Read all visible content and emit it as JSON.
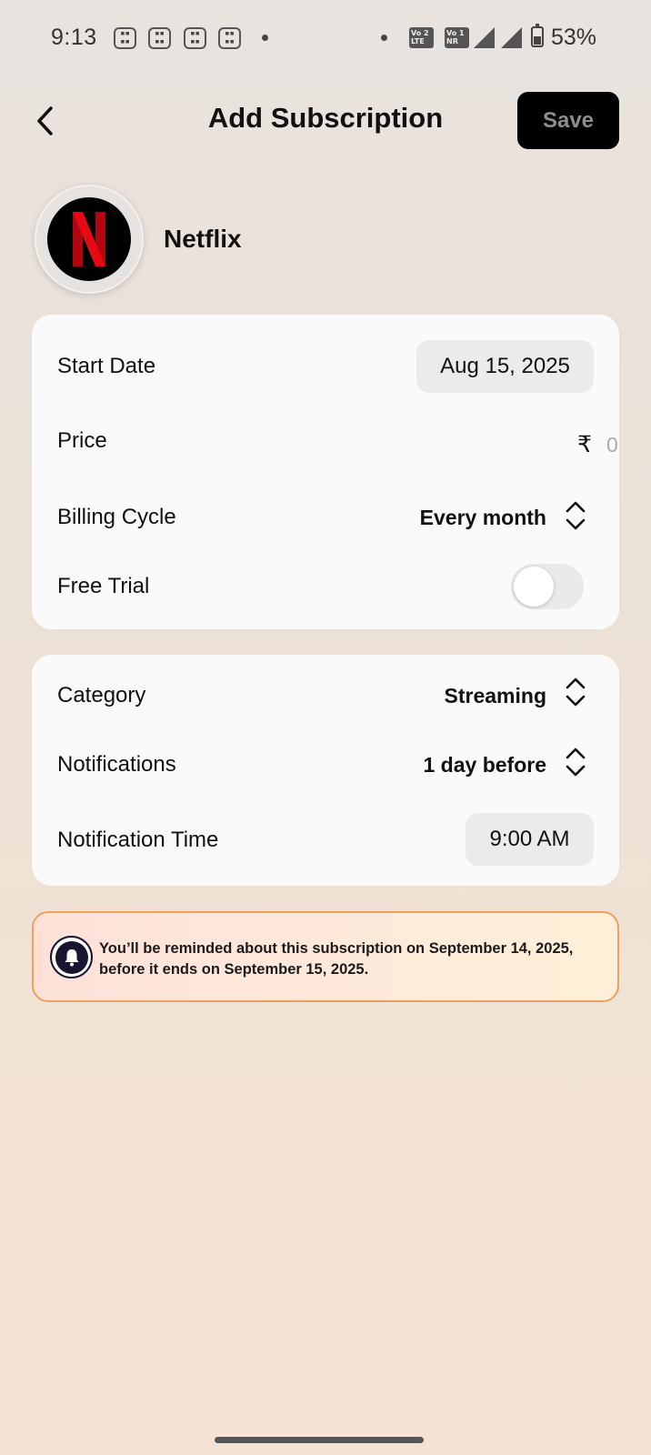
{
  "status_bar": {
    "time": "9:13",
    "battery": "53%",
    "sim1_label": "Vo 2 LTE",
    "sim2_label": "Vo 1 NR",
    "notification_icons": [
      "calculator-icon",
      "calculator-icon",
      "calculator-icon",
      "calculator-icon"
    ]
  },
  "header": {
    "title": "Add Subscription",
    "save_label": "Save"
  },
  "service": {
    "name": "Netflix",
    "logo_letter": "N",
    "brand_color": "#e50914"
  },
  "details": {
    "start_date": {
      "label": "Start Date",
      "value": "Aug 15, 2025"
    },
    "price": {
      "label": "Price",
      "currency": "₹",
      "placeholder": "0"
    },
    "billing_cycle": {
      "label": "Billing Cycle",
      "value": "Every month"
    },
    "free_trial": {
      "label": "Free Trial",
      "enabled": false
    }
  },
  "settings": {
    "category": {
      "label": "Category",
      "value": "Streaming"
    },
    "notifications": {
      "label": "Notifications",
      "value": "1 day before"
    },
    "notification_time": {
      "label": "Notification Time",
      "value": "9:00 AM"
    }
  },
  "reminder": {
    "text": "You’ll be reminded about this subscription on September 14, 2025, before it ends on September 15, 2025."
  }
}
